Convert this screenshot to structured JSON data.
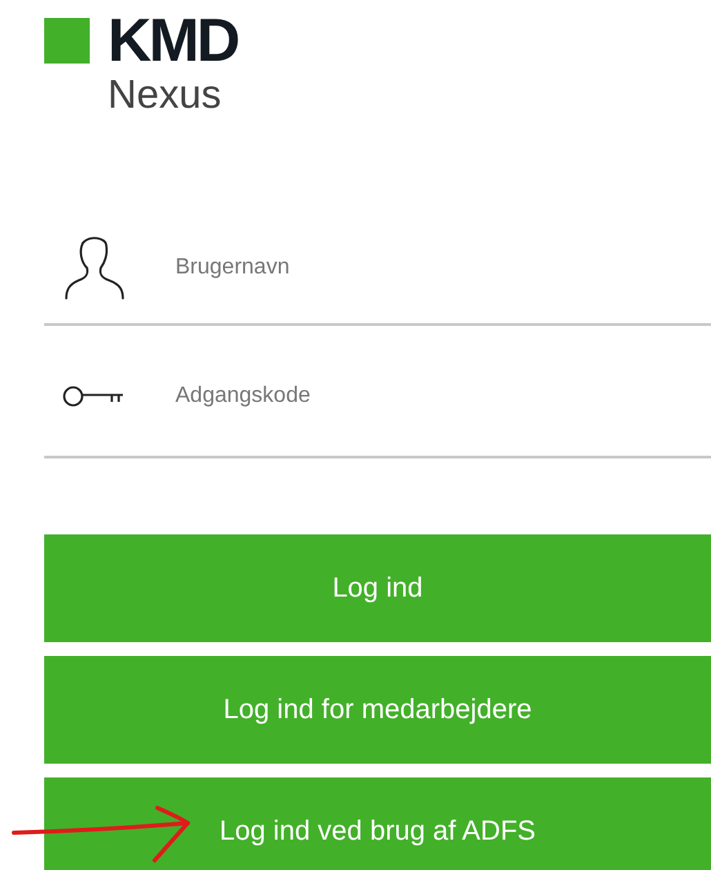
{
  "logo": {
    "brand": "KMD",
    "product": "Nexus"
  },
  "fields": [
    {
      "kind": "user",
      "placeholder": "Brugernavn"
    },
    {
      "kind": "password",
      "placeholder": "Adgangskode"
    }
  ],
  "buttons": [
    {
      "label": "Log ind"
    },
    {
      "label": "Log ind for medarbejdere"
    },
    {
      "label": "Log ind ved brug af ADFS"
    }
  ]
}
